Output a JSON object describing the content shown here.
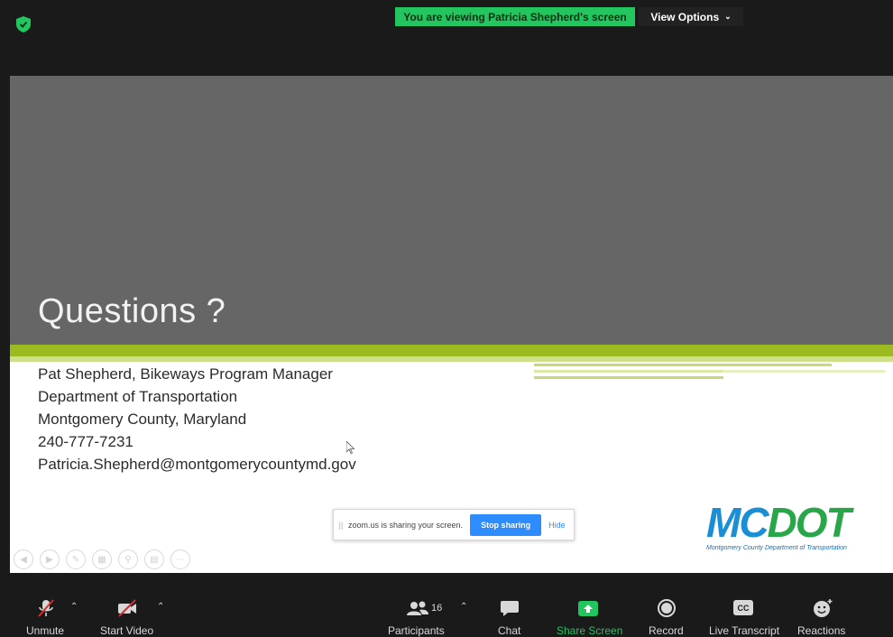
{
  "top_bar": {
    "viewing_banner": "You are viewing Patricia Shepherd's screen",
    "view_options": "View Options"
  },
  "slide": {
    "title": "Questions ?",
    "contact_lines": [
      "Pat Shepherd, Bikeways Program Manager",
      "Department of Transportation",
      "Montgomery County, Maryland",
      "240-777-7231",
      "Patricia.Shepherd@montgomerycountymd.gov"
    ],
    "logo_mark_mc": "MC",
    "logo_mark_dot": "DOT",
    "logo_subtitle": "Montgomery County Department of Transportation"
  },
  "share_notice": {
    "message": "zoom.us is sharing your screen.",
    "stop_label": "Stop sharing",
    "hide_label": "Hide"
  },
  "toolbar": {
    "unmute": "Unmute",
    "start_video": "Start Video",
    "participants": "Participants",
    "participants_count": "16",
    "chat": "Chat",
    "share_screen": "Share Screen",
    "record": "Record",
    "live_transcript": "Live Transcript",
    "reactions": "Reactions",
    "cc": "CC"
  },
  "colors": {
    "banner_green": "#23c55e",
    "share_green": "#23c55e",
    "accent_blue": "#2d8cff",
    "slide_band": "#9bbb1e"
  }
}
